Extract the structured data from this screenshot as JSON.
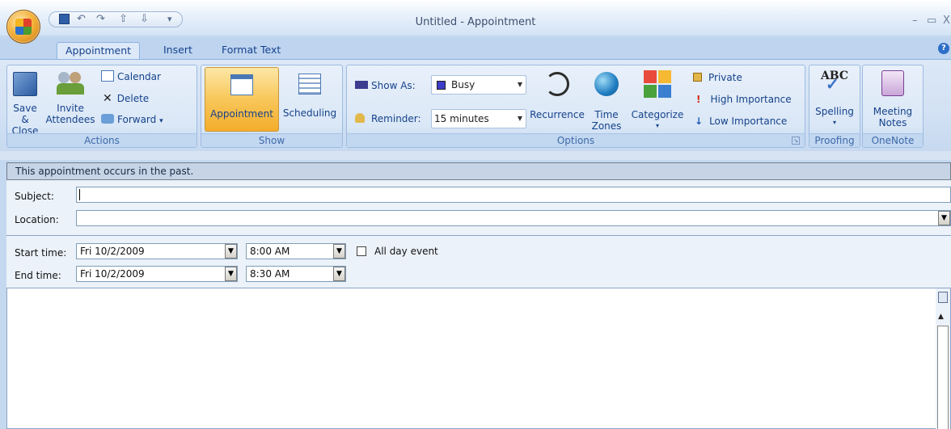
{
  "window": {
    "title": "Untitled - Appointment",
    "minimize_glyph": "–",
    "maximize_glyph": "▭",
    "close_glyph": "X"
  },
  "quick_access": {
    "save_icon": "save-icon",
    "undo_glyph": "↶",
    "redo_glyph": "↷",
    "prev_glyph": "⇧",
    "next_glyph": "⇩",
    "customize_glyph": "▾"
  },
  "tabs": [
    {
      "label": "Appointment",
      "active": true
    },
    {
      "label": "Insert",
      "active": false
    },
    {
      "label": "Format Text",
      "active": false
    }
  ],
  "help_glyph": "?",
  "ribbon": {
    "actions": {
      "group_label": "Actions",
      "save_close_line1": "Save &",
      "save_close_line2": "Close",
      "invite_line1": "Invite",
      "invite_line2": "Attendees",
      "calendar": "Calendar",
      "delete": "Delete",
      "delete_glyph": "✕",
      "forward": "Forward",
      "forward_arrow": "▾"
    },
    "show": {
      "group_label": "Show",
      "appointment": "Appointment",
      "scheduling": "Scheduling"
    },
    "options": {
      "group_label": "Options",
      "show_as_label": "Show As:",
      "show_as_value": "Busy",
      "reminder_label": "Reminder:",
      "reminder_value": "15 minutes",
      "recurrence": "Recurrence",
      "time_zones_line1": "Time",
      "time_zones_line2": "Zones",
      "categorize": "Categorize",
      "categorize_arrow": "▾",
      "private": "Private",
      "high_importance": "High Importance",
      "low_importance": "Low Importance",
      "launcher_glyph": "↘"
    },
    "proofing": {
      "group_label": "Proofing",
      "spelling": "Spelling",
      "spelling_arrow": "▾",
      "abc": "ABC"
    },
    "onenote": {
      "group_label": "OneNote",
      "meeting_line1": "Meeting",
      "meeting_line2": "Notes"
    }
  },
  "infobar": {
    "message": "This appointment occurs in the past."
  },
  "form": {
    "subject_label": "Subject:",
    "subject_value": "",
    "location_label": "Location:",
    "location_value": "",
    "start_label": "Start time:",
    "start_date": "Fri 10/2/2009",
    "start_time": "8:00 AM",
    "all_day_label": "All day event",
    "all_day_checked": false,
    "end_label": "End time:",
    "end_date": "Fri 10/2/2009",
    "end_time": "8:30 AM",
    "dropdown_glyph": "▼"
  },
  "scrollbar": {
    "up_glyph": "▲"
  },
  "colors": {
    "accent": "#15428b",
    "ribbon_bg": "#d2e1f4",
    "active_button": "#f8c75a",
    "infobar_bg": "#c6d4e6"
  }
}
